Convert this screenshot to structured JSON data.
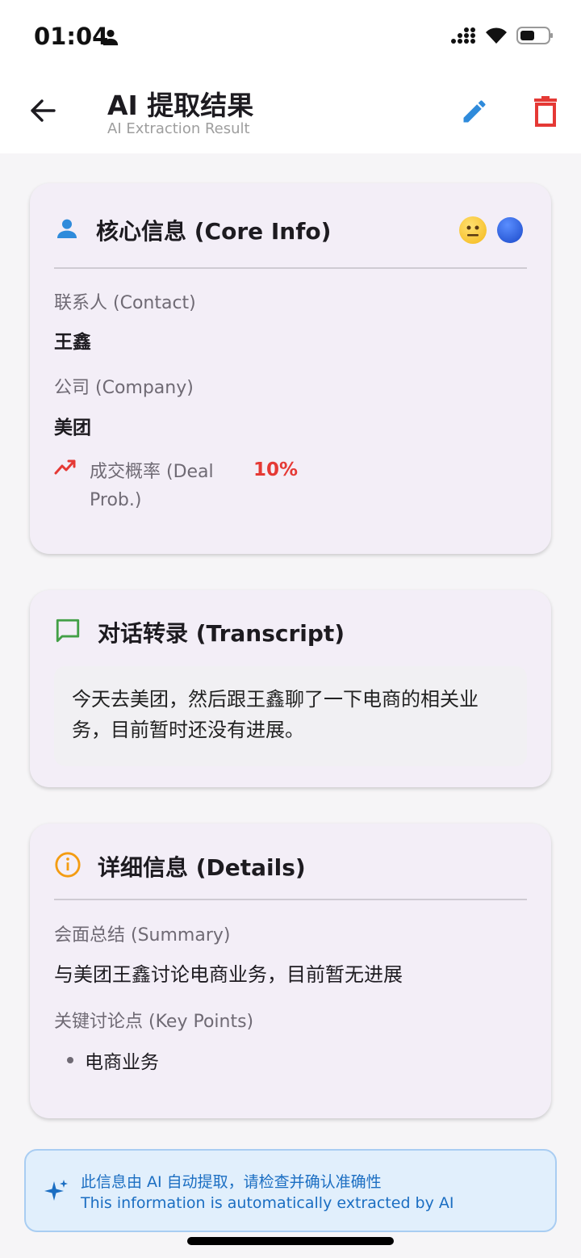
{
  "status_bar": {
    "time": "01:04"
  },
  "app_bar": {
    "title": "AI 提取结果",
    "subtitle": "AI Extraction Result"
  },
  "core_info": {
    "title": "核心信息 (Core Info)",
    "contact_label": "联系人 (Contact)",
    "contact_value": "王鑫",
    "company_label": "公司 (Company)",
    "company_value": "美团",
    "deal_prob_label_line1": "成交概率 (Deal",
    "deal_prob_label_line2": "Prob.)",
    "deal_prob_value": "10%"
  },
  "transcript": {
    "title": "对话转录 (Transcript)",
    "text": "今天去美团，然后跟王鑫聊了一下电商的相关业务，目前暂时还没有进展。"
  },
  "details": {
    "title": "详细信息 (Details)",
    "summary_label": "会面总结 (Summary)",
    "summary_value": "与美团王鑫讨论电商业务，目前暂无进展",
    "key_points_label": "关键讨论点 (Key Points)",
    "key_points": [
      "电商业务"
    ]
  },
  "banner": {
    "line1": "此信息由 AI 自动提取，请检查并确认准确性",
    "line2": "This information is automatically extracted by AI"
  },
  "colors": {
    "accent_blue": "#2f8bdb",
    "delete_red": "#e53935",
    "deal_red": "#e53935",
    "transcript_green": "#43a047",
    "details_orange": "#f39c12",
    "card_bg": "#f3eef7"
  },
  "icons": {
    "back": "arrow-left-icon",
    "edit": "pencil-icon",
    "delete": "trash-icon",
    "core": "person-icon",
    "sentiment": "neutral-face-icon",
    "status_dot": "blue-circle-icon",
    "trend": "trending-up-icon",
    "transcript": "chat-bubble-icon",
    "details": "info-icon",
    "banner": "sparkle-icon"
  }
}
